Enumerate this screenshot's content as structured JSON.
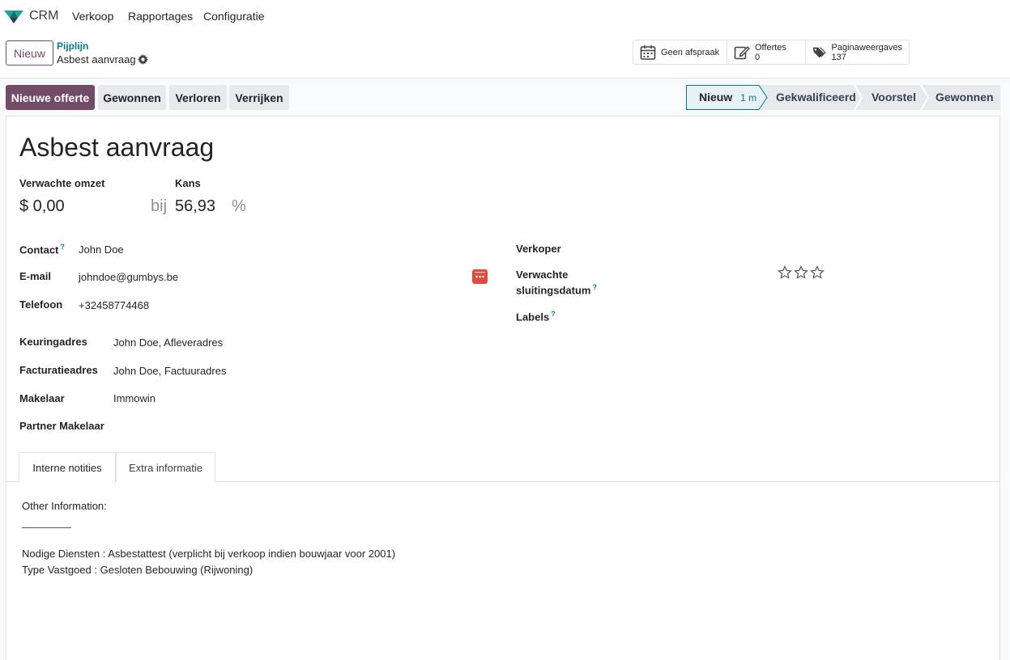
{
  "navbar": {
    "app_name": "CRM",
    "menu": [
      "Verkoop",
      "Rapportages",
      "Configuratie"
    ]
  },
  "control": {
    "new_label": "Nieuw",
    "breadcrumb_parent": "Pijplijn",
    "breadcrumb_current": "Asbest aanvraag",
    "stats": {
      "meeting": "Geen afspraak",
      "quotes_label": "Offertes",
      "quotes_count": "0",
      "pageviews_label": "Paginaweergaves",
      "pageviews_count": "137"
    }
  },
  "statusbar": {
    "actions": [
      "Nieuwe offerte",
      "Gewonnen",
      "Verloren",
      "Verrijken"
    ],
    "stages": [
      {
        "label": "Nieuw",
        "duration": "1 m",
        "active": true
      },
      {
        "label": "Gekwalificeerd",
        "active": false
      },
      {
        "label": "Voorstel",
        "active": false
      },
      {
        "label": "Gewonnen",
        "active": false
      }
    ]
  },
  "form": {
    "title": "Asbest aanvraag",
    "revenue_label": "Verwachte omzet",
    "revenue_value": "$ 0,00",
    "at_label": "bij",
    "probability_label": "Kans",
    "probability_value": "56,93",
    "percent": "%",
    "contact_label": "Contact",
    "contact_value": "John Doe",
    "email_label": "E-mail",
    "email_value": "johndoe@gumbys.be",
    "phone_label": "Telefoon",
    "phone_value": "+32458774468",
    "inspection_address_label": "Keuringadres",
    "inspection_address_value": "John Doe, Afleveradres",
    "invoice_address_label": "Facturatieadres",
    "invoice_address_value": "John Doe, Factuuradres",
    "broker_label": "Makelaar",
    "broker_value": "Immowin",
    "partner_broker_label": "Partner Makelaar",
    "salesperson_label": "Verkoper",
    "expected_close_label_1": "Verwachte",
    "expected_close_label_2": "sluitingsdatum",
    "labels_label": "Labels",
    "priority_stars": 0,
    "help": "?"
  },
  "tabs": {
    "internal_notes": "Interne notities",
    "extra_info": "Extra informatie"
  },
  "notes": {
    "line1": "Other Information:",
    "line2": "Nodige Diensten : Asbestattest (verplicht bij verkoop indien bouwjaar voor 2001)",
    "line3": "Type Vastgoed : Gesloten Bebouwing (Rijwoning)"
  },
  "colors": {
    "primary": "#714b67",
    "accent": "#017e84",
    "email_icon": "#e04a3f"
  }
}
